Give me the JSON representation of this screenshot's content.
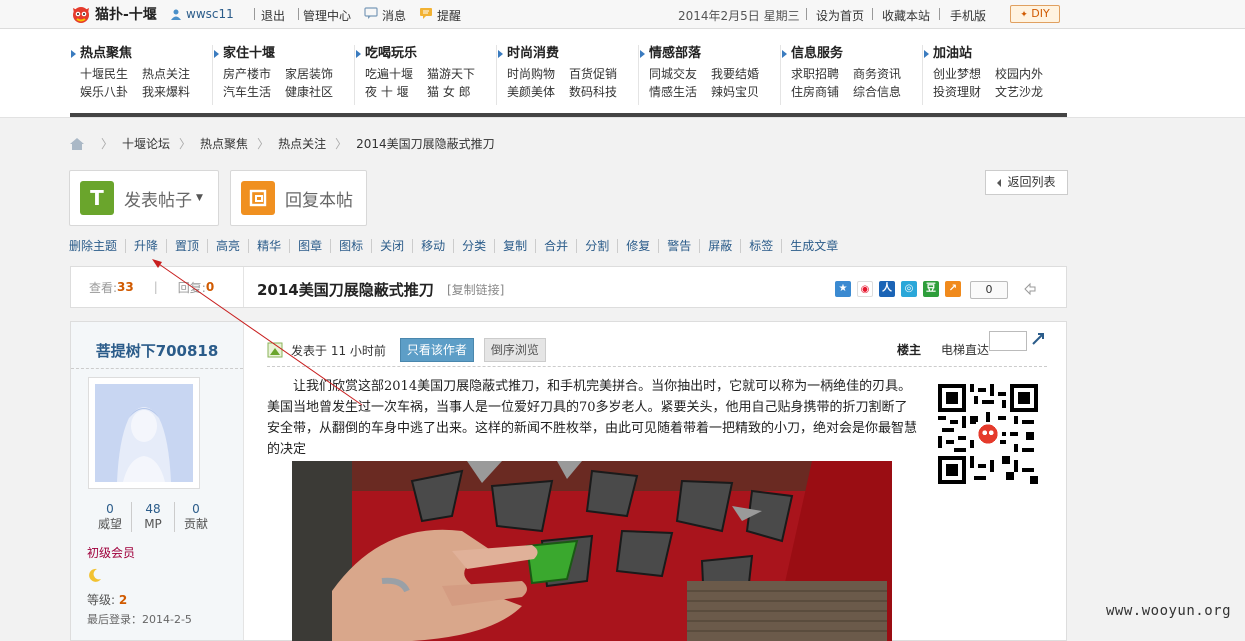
{
  "topbar": {
    "site_name": "猫扑-十堰",
    "username": "wwsc11",
    "logout": "退出",
    "admin": "管理中心",
    "messages": "消息",
    "reminders": "提醒",
    "date": "2014年2月5日 星期三",
    "set_home": "设为首页",
    "bookmark": "收藏本站",
    "mobile": "手机版",
    "diy": "DIY"
  },
  "nav": [
    {
      "title": "热点聚焦",
      "links": [
        "十堰民生",
        "热点关注",
        "娱乐八卦",
        "我来爆料"
      ]
    },
    {
      "title": "家住十堰",
      "links": [
        "房产楼市",
        "家居装饰",
        "汽车生活",
        "健康社区"
      ]
    },
    {
      "title": "吃喝玩乐",
      "links": [
        "吃遍十堰",
        "猫游天下",
        "夜 十 堰",
        "猫 女 郎"
      ]
    },
    {
      "title": "时尚消费",
      "links": [
        "时尚购物",
        "百货促销",
        "美颜美体",
        "数码科技"
      ]
    },
    {
      "title": "情感部落",
      "links": [
        "同城交友",
        "我要结婚",
        "情感生活",
        "辣妈宝贝"
      ]
    },
    {
      "title": "信息服务",
      "links": [
        "求职招聘",
        "商务资讯",
        "住房商铺",
        "综合信息"
      ]
    },
    {
      "title": "加油站",
      "links": [
        "创业梦想",
        "校园内外",
        "投资理财",
        "文艺沙龙"
      ]
    }
  ],
  "breadcrumb": [
    "十堰论坛",
    "热点聚焦",
    "热点关注",
    "2014美国刀展隐蔽式推刀"
  ],
  "actions": {
    "new_post": "发表帖子",
    "reply": "回复本帖",
    "back_to_list": "返回列表"
  },
  "mod_tools": [
    "删除主题",
    "升降",
    "置顶",
    "高亮",
    "精华",
    "图章",
    "图标",
    "关闭",
    "移动",
    "分类",
    "复制",
    "合并",
    "分割",
    "修复",
    "警告",
    "屏蔽",
    "标签",
    "生成文章"
  ],
  "thread": {
    "views_label": "查看:",
    "views": "33",
    "replies_label": "回复:",
    "replies": "0",
    "title": "2014美国刀展隐蔽式推刀",
    "copy_link": "[复制链接]",
    "share_count": "0"
  },
  "author": {
    "name": "菩提树下700818",
    "stats": [
      {
        "value": "0",
        "label": "威望"
      },
      {
        "value": "48",
        "label": "MP"
      },
      {
        "value": "0",
        "label": "贡献"
      }
    ],
    "rank": "初级会员",
    "level_label": "等级:",
    "level": "2",
    "last_login": "最后登录：2014-2-5"
  },
  "post": {
    "posted_at": "发表于 11 小时前",
    "author_only": "只看该作者",
    "reverse": "倒序浏览",
    "floor": "楼主",
    "elevator": "电梯直达",
    "body": "让我们欣赏这部2014美国刀展隐蔽式推刀，和手机完美拼合。当你抽出时，它就可以称为一柄绝佳的刃具。美国当地曾发生过一次车祸，当事人是一位爱好刀具的70多岁老人。紧要关头，他用自己贴身携带的折刀割断了安全带，从翻倒的车身中逃了出来。这样的新闻不胜枚举，由此可见随着带着一把精致的小刀，绝对会是你最智慧的决定"
  },
  "watermark": "www.wooyun.org",
  "colors": {
    "link_blue": "#2b5c8a",
    "accent_orange": "#d05a00",
    "new_post_green": "#6aa52c",
    "reply_orange": "#f09020",
    "annotation_red": "#c81e1e"
  }
}
